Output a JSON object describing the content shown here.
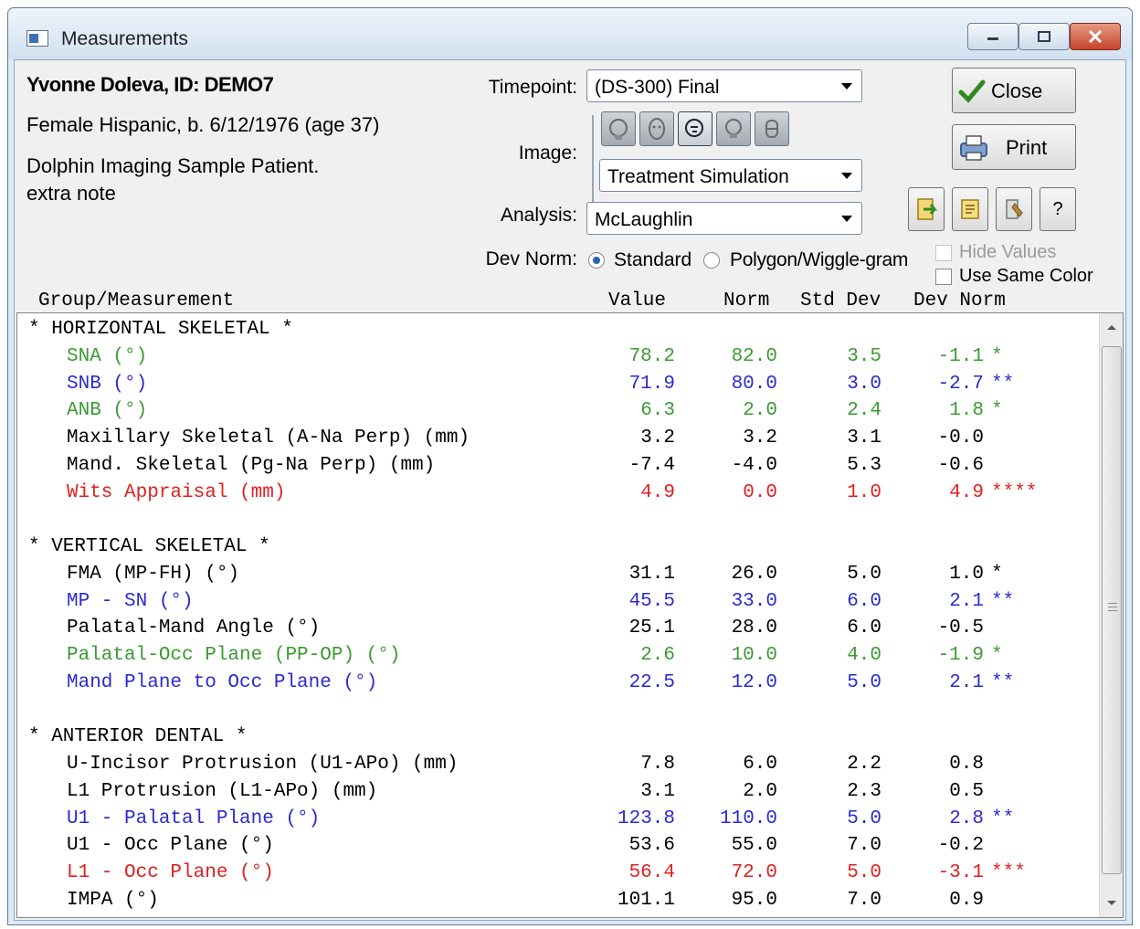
{
  "window": {
    "title": "Measurements"
  },
  "patient": {
    "name": "Yvonne Doleva,  ID: DEMO7",
    "info": "Female Hispanic, b. 6/12/1976 (age 37)",
    "description": "Dolphin Imaging Sample Patient.",
    "note": "extra note"
  },
  "controls": {
    "timepoint_label": "Timepoint:",
    "timepoint_value": "(DS-300) Final",
    "image_label": "Image:",
    "image_value": "Treatment Simulation",
    "analysis_label": "Analysis:",
    "analysis_value": "McLaughlin",
    "devnorm_label": "Dev Norm:",
    "devnorm_options": [
      "Standard",
      "Polygon/Wiggle-gram"
    ],
    "devnorm_selected": "Standard",
    "hide_values_label": "Hide Values",
    "use_same_color_label": "Use Same Color"
  },
  "buttons": {
    "close": "Close",
    "print": "Print",
    "help": "?"
  },
  "columns": [
    "Group/Measurement",
    "Value",
    "Norm",
    "Std Dev",
    "Dev Norm"
  ],
  "groups": [
    {
      "title": "* HORIZONTAL SKELETAL *",
      "rows": [
        {
          "name": "SNA (°)",
          "value": "78.2",
          "norm": "82.0",
          "std": "3.5",
          "dev": "-1.1",
          "stars": "*",
          "color": "#3c9a32"
        },
        {
          "name": "SNB (°)",
          "value": "71.9",
          "norm": "80.0",
          "std": "3.0",
          "dev": "-2.7",
          "stars": "**",
          "color": "#2a2ad0"
        },
        {
          "name": "ANB (°)",
          "value": "6.3",
          "norm": "2.0",
          "std": "2.4",
          "dev": "1.8",
          "stars": "*",
          "color": "#3c9a32"
        },
        {
          "name": "Maxillary Skeletal (A-Na Perp) (mm)",
          "value": "3.2",
          "norm": "3.2",
          "std": "3.1",
          "dev": "-0.0",
          "stars": "",
          "color": "#000000"
        },
        {
          "name": "Mand. Skeletal (Pg-Na Perp) (mm)",
          "value": "-7.4",
          "norm": "-4.0",
          "std": "5.3",
          "dev": "-0.6",
          "stars": "",
          "color": "#000000"
        },
        {
          "name": "Wits Appraisal (mm)",
          "value": "4.9",
          "norm": "0.0",
          "std": "1.0",
          "dev": "4.9",
          "stars": "****",
          "color": "#e02020"
        }
      ]
    },
    {
      "title": "* VERTICAL SKELETAL *",
      "rows": [
        {
          "name": "FMA (MP-FH) (°)",
          "value": "31.1",
          "norm": "26.0",
          "std": "5.0",
          "dev": "1.0",
          "stars": "*",
          "color": "#000000"
        },
        {
          "name": "MP - SN (°)",
          "value": "45.5",
          "norm": "33.0",
          "std": "6.0",
          "dev": "2.1",
          "stars": "**",
          "color": "#2a2ad0"
        },
        {
          "name": "Palatal-Mand Angle (°)",
          "value": "25.1",
          "norm": "28.0",
          "std": "6.0",
          "dev": "-0.5",
          "stars": "",
          "color": "#000000"
        },
        {
          "name": "Palatal-Occ Plane (PP-OP) (°)",
          "value": "2.6",
          "norm": "10.0",
          "std": "4.0",
          "dev": "-1.9",
          "stars": "*",
          "color": "#3c9a32"
        },
        {
          "name": "Mand Plane to Occ Plane (°)",
          "value": "22.5",
          "norm": "12.0",
          "std": "5.0",
          "dev": "2.1",
          "stars": "**",
          "color": "#2a2ad0"
        }
      ]
    },
    {
      "title": "* ANTERIOR DENTAL *",
      "rows": [
        {
          "name": "U-Incisor Protrusion (U1-APo) (mm)",
          "value": "7.8",
          "norm": "6.0",
          "std": "2.2",
          "dev": "0.8",
          "stars": "",
          "color": "#000000"
        },
        {
          "name": "L1 Protrusion (L1-APo) (mm)",
          "value": "3.1",
          "norm": "2.0",
          "std": "2.3",
          "dev": "0.5",
          "stars": "",
          "color": "#000000"
        },
        {
          "name": "U1 - Palatal Plane (°)",
          "value": "123.8",
          "norm": "110.0",
          "std": "5.0",
          "dev": "2.8",
          "stars": "**",
          "color": "#2a2ad0"
        },
        {
          "name": "U1 - Occ Plane (°)",
          "value": "53.6",
          "norm": "55.0",
          "std": "7.0",
          "dev": "-0.2",
          "stars": "",
          "color": "#000000"
        },
        {
          "name": "L1 - Occ Plane (°)",
          "value": "56.4",
          "norm": "72.0",
          "std": "5.0",
          "dev": "-3.1",
          "stars": "***",
          "color": "#e02020"
        },
        {
          "name": "IMPA (°)",
          "value": "101.1",
          "norm": "95.0",
          "std": "7.0",
          "dev": "0.9",
          "stars": "",
          "color": "#000000"
        }
      ]
    }
  ]
}
